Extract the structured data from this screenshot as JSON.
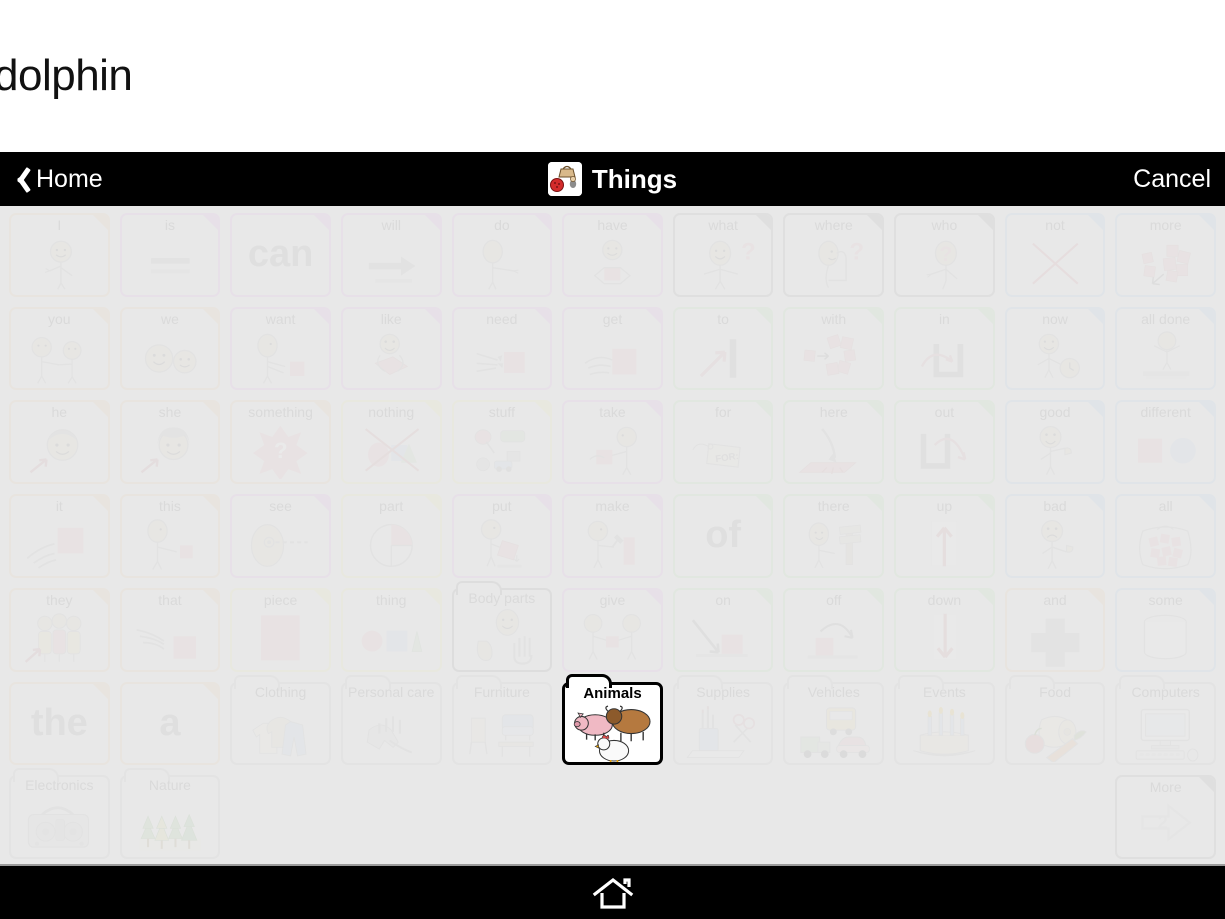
{
  "utterance": {
    "text": "dolphin"
  },
  "navbar": {
    "back_label": "Home",
    "back_icon": "chevron-left-icon",
    "title": "Things",
    "title_icon": "things-basket-icon",
    "cancel_label": "Cancel"
  },
  "bottombar": {
    "home_icon": "home-icon"
  },
  "colors": {
    "navbar_bg": "#000000",
    "grid_bg": "#e8e8e8",
    "cell_bg": "#eaeaea",
    "selected_border": "#000000",
    "pronoun_orange": "#f0c99a",
    "verb_pink": "#e2a6e8",
    "question_grey": "#9a9a9a",
    "describe_blue": "#a8cdea",
    "preposition_green": "#aee0a6",
    "noun_yellow": "#ece89a",
    "folder_grey": "#bdbdbd"
  },
  "grid": {
    "columns": 11,
    "rows": 7,
    "cells": [
      {
        "label": "I",
        "border": "orange",
        "type": "word",
        "art": "person-pointing-self"
      },
      {
        "label": "is",
        "border": "pink",
        "type": "word",
        "art": "equals-lines"
      },
      {
        "label": "can",
        "border": "pink",
        "type": "bigword",
        "art": ""
      },
      {
        "label": "will",
        "border": "pink",
        "type": "word",
        "art": "arrow-right"
      },
      {
        "label": "do",
        "border": "pink",
        "type": "word",
        "art": "person-reaching"
      },
      {
        "label": "have",
        "border": "pink",
        "type": "word",
        "art": "person-holding-box"
      },
      {
        "label": "what",
        "border": "grey",
        "type": "word",
        "art": "person-question"
      },
      {
        "label": "where",
        "border": "grey",
        "type": "word",
        "art": "person-looking-question"
      },
      {
        "label": "who",
        "border": "grey",
        "type": "word",
        "art": "person-face-question"
      },
      {
        "label": "not",
        "border": "blue",
        "type": "word",
        "art": "red-x"
      },
      {
        "label": "more",
        "border": "blue",
        "type": "word",
        "art": "many-squares-arrow"
      },
      {
        "label": "you",
        "border": "orange",
        "type": "word",
        "art": "two-people-pointing"
      },
      {
        "label": "we",
        "border": "orange",
        "type": "word",
        "art": "two-faces"
      },
      {
        "label": "want",
        "border": "pink",
        "type": "word",
        "art": "person-reaching-box"
      },
      {
        "label": "like",
        "border": "pink",
        "type": "word",
        "art": "person-hugging-paper"
      },
      {
        "label": "need",
        "border": "pink",
        "type": "word",
        "art": "hands-grabbing-box"
      },
      {
        "label": "get",
        "border": "pink",
        "type": "word",
        "art": "hand-taking-box"
      },
      {
        "label": "to",
        "border": "green",
        "type": "word",
        "art": "arrow-to-wall"
      },
      {
        "label": "with",
        "border": "green",
        "type": "word",
        "art": "square-joining-group"
      },
      {
        "label": "in",
        "border": "green",
        "type": "word",
        "art": "arrow-into-container"
      },
      {
        "label": "now",
        "border": "blue",
        "type": "word",
        "art": "person-clock"
      },
      {
        "label": "all done",
        "border": "blue",
        "type": "word",
        "art": "person-hands-up-table"
      },
      {
        "label": "he",
        "border": "orange",
        "type": "word",
        "art": "male-face-arrow"
      },
      {
        "label": "she",
        "border": "orange",
        "type": "word",
        "art": "female-face-arrow"
      },
      {
        "label": "something",
        "border": "orange",
        "type": "word",
        "art": "blob-question"
      },
      {
        "label": "nothing",
        "border": "yellow",
        "type": "word",
        "art": "shapes-crossed-out"
      },
      {
        "label": "stuff",
        "border": "yellow",
        "type": "word",
        "art": "assorted-objects"
      },
      {
        "label": "take",
        "border": "pink",
        "type": "word",
        "art": "person-taking-box"
      },
      {
        "label": "for",
        "border": "green",
        "type": "word",
        "art": "gift-tag"
      },
      {
        "label": "here",
        "border": "green",
        "type": "word",
        "art": "hand-pointing-surface"
      },
      {
        "label": "out",
        "border": "green",
        "type": "word",
        "art": "arrow-out-of-container"
      },
      {
        "label": "good",
        "border": "blue",
        "type": "word",
        "art": "person-thumbs-up"
      },
      {
        "label": "different",
        "border": "blue",
        "type": "word",
        "art": "square-and-circle"
      },
      {
        "label": "it",
        "border": "orange",
        "type": "word",
        "art": "hand-pointing-square"
      },
      {
        "label": "this",
        "border": "orange",
        "type": "word",
        "art": "person-pointing-square"
      },
      {
        "label": "see",
        "border": "pink",
        "type": "word",
        "art": "eye-with-dotted-line"
      },
      {
        "label": "part",
        "border": "yellow",
        "type": "word",
        "art": "pie-chart-slice"
      },
      {
        "label": "put",
        "border": "pink",
        "type": "word",
        "art": "person-placing-box"
      },
      {
        "label": "make",
        "border": "pink",
        "type": "word",
        "art": "person-hammering"
      },
      {
        "label": "of",
        "border": "green",
        "type": "bigword",
        "art": ""
      },
      {
        "label": "there",
        "border": "green",
        "type": "word",
        "art": "person-pointing-signpost"
      },
      {
        "label": "up",
        "border": "green",
        "type": "word",
        "art": "arrow-up"
      },
      {
        "label": "bad",
        "border": "blue",
        "type": "word",
        "art": "person-thumbs-down"
      },
      {
        "label": "all",
        "border": "blue",
        "type": "word",
        "art": "bag-of-squares"
      },
      {
        "label": "they",
        "border": "orange",
        "type": "word",
        "art": "three-people-arrow"
      },
      {
        "label": "that",
        "border": "orange",
        "type": "word",
        "art": "hand-pointing-away-square"
      },
      {
        "label": "piece",
        "border": "yellow",
        "type": "word",
        "art": "single-square"
      },
      {
        "label": "thing",
        "border": "yellow",
        "type": "word",
        "art": "circle-square-triangle"
      },
      {
        "label": "Body parts",
        "border": "dgrey",
        "type": "folder",
        "art": "face-foot-hand"
      },
      {
        "label": "give",
        "border": "pink",
        "type": "word",
        "art": "two-people-exchange"
      },
      {
        "label": "on",
        "border": "green",
        "type": "word",
        "art": "arrow-onto-surface"
      },
      {
        "label": "off",
        "border": "green",
        "type": "word",
        "art": "arrow-off-surface"
      },
      {
        "label": "down",
        "border": "green",
        "type": "word",
        "art": "arrow-down"
      },
      {
        "label": "and",
        "border": "orange",
        "type": "word",
        "art": "plus-sign"
      },
      {
        "label": "some",
        "border": "blue",
        "type": "word",
        "art": "cylinder-container"
      },
      {
        "label": "the",
        "border": "orange",
        "type": "bigword",
        "art": ""
      },
      {
        "label": "a",
        "border": "orange",
        "type": "bigword",
        "art": ""
      },
      {
        "label": "Clothing",
        "border": "folder",
        "type": "folder",
        "art": "shirt-pants"
      },
      {
        "label": "Personal care",
        "border": "folder",
        "type": "folder",
        "art": "washing-hands"
      },
      {
        "label": "Furniture",
        "border": "folder",
        "type": "folder",
        "art": "sofa-chair-table"
      },
      {
        "label": "Animals",
        "border": "selected",
        "type": "folder",
        "art": "pig-cow-chicken",
        "selected": true
      },
      {
        "label": "Supplies",
        "border": "folder",
        "type": "folder",
        "art": "pencil-cup-scissors"
      },
      {
        "label": "Vehicles",
        "border": "folder",
        "type": "folder",
        "art": "bus-truck-car"
      },
      {
        "label": "Events",
        "border": "folder",
        "type": "folder",
        "art": "birthday-cake"
      },
      {
        "label": "Food",
        "border": "folder",
        "type": "folder",
        "art": "bread-apple-carrot"
      },
      {
        "label": "Computers",
        "border": "folder",
        "type": "folder",
        "art": "monitor-keyboard"
      },
      {
        "label": "Electronics",
        "border": "folder",
        "type": "folder",
        "art": "radio-boombox"
      },
      {
        "label": "Nature",
        "border": "folder",
        "type": "folder",
        "art": "pine-trees"
      },
      {
        "label": "",
        "border": "none",
        "type": "empty",
        "art": ""
      },
      {
        "label": "",
        "border": "none",
        "type": "empty",
        "art": ""
      },
      {
        "label": "",
        "border": "none",
        "type": "empty",
        "art": ""
      },
      {
        "label": "",
        "border": "none",
        "type": "empty",
        "art": ""
      },
      {
        "label": "",
        "border": "none",
        "type": "empty",
        "art": ""
      },
      {
        "label": "",
        "border": "none",
        "type": "empty",
        "art": ""
      },
      {
        "label": "",
        "border": "none",
        "type": "empty",
        "art": ""
      },
      {
        "label": "",
        "border": "none",
        "type": "empty",
        "art": ""
      },
      {
        "label": "More",
        "border": "grey",
        "type": "more",
        "art": "arrow-right-page",
        "page_number": "2"
      }
    ]
  }
}
